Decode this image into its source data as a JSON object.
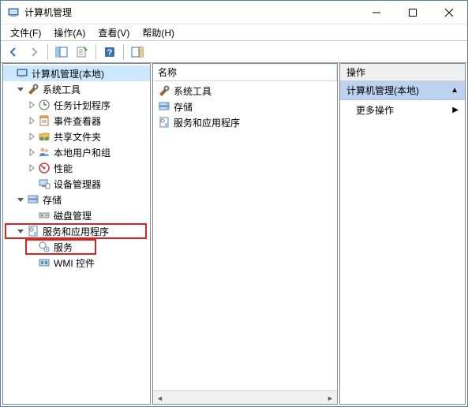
{
  "window": {
    "title": "计算机管理"
  },
  "menu": {
    "file": "文件(F)",
    "action": "操作(A)",
    "view": "查看(V)",
    "help": "帮助(H)"
  },
  "tree": {
    "root": "计算机管理(本地)",
    "system_tools": "系统工具",
    "task_scheduler": "任务计划程序",
    "event_viewer": "事件查看器",
    "shared_folders": "共享文件夹",
    "local_users": "本地用户和组",
    "performance": "性能",
    "device_manager": "设备管理器",
    "storage": "存储",
    "disk_management": "磁盘管理",
    "services_apps": "服务和应用程序",
    "services": "服务",
    "wmi": "WMI 控件"
  },
  "list": {
    "header_name": "名称",
    "items": {
      "system_tools": "系统工具",
      "storage": "存储",
      "services_apps": "服务和应用程序"
    }
  },
  "actions": {
    "header": "操作",
    "section_title": "计算机管理(本地)",
    "more_actions": "更多操作"
  }
}
